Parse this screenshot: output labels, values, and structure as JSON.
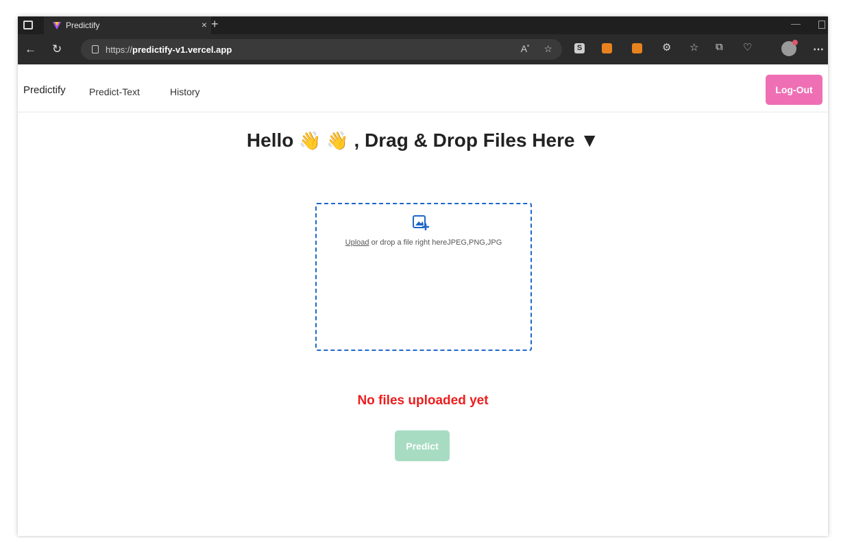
{
  "browser": {
    "tab_title": "Predictify",
    "tab_close": "×",
    "new_tab": "+",
    "url_scheme": "https://",
    "url_host": "predictify-v1.vercel.app",
    "icons": [
      "back-icon",
      "refresh-icon",
      "lock-icon",
      "read-aloud-icon",
      "favorite-star-icon",
      "extension-icons",
      "favorites-icon",
      "collections-icon",
      "health-icon",
      "profile-avatar",
      "more-icon"
    ]
  },
  "navbar": {
    "brand": "Predictify",
    "links": [
      "Predict-Text",
      "History"
    ],
    "logout_label": "Log-Out",
    "logout_color": "#ef6fb4"
  },
  "hero": {
    "hello": "Hello",
    "emoji": "👋",
    "text": ", Drag & Drop Files Here",
    "arrow": "▼"
  },
  "dropzone": {
    "upload_link": "Upload",
    "text": " or drop a file right hereJPEG,PNG,JPG",
    "border_color": "#1b66c9"
  },
  "status": {
    "message": "No files uploaded yet",
    "color": "#ee1c1c"
  },
  "predict": {
    "label": "Predict",
    "color": "#a7dcc3"
  }
}
